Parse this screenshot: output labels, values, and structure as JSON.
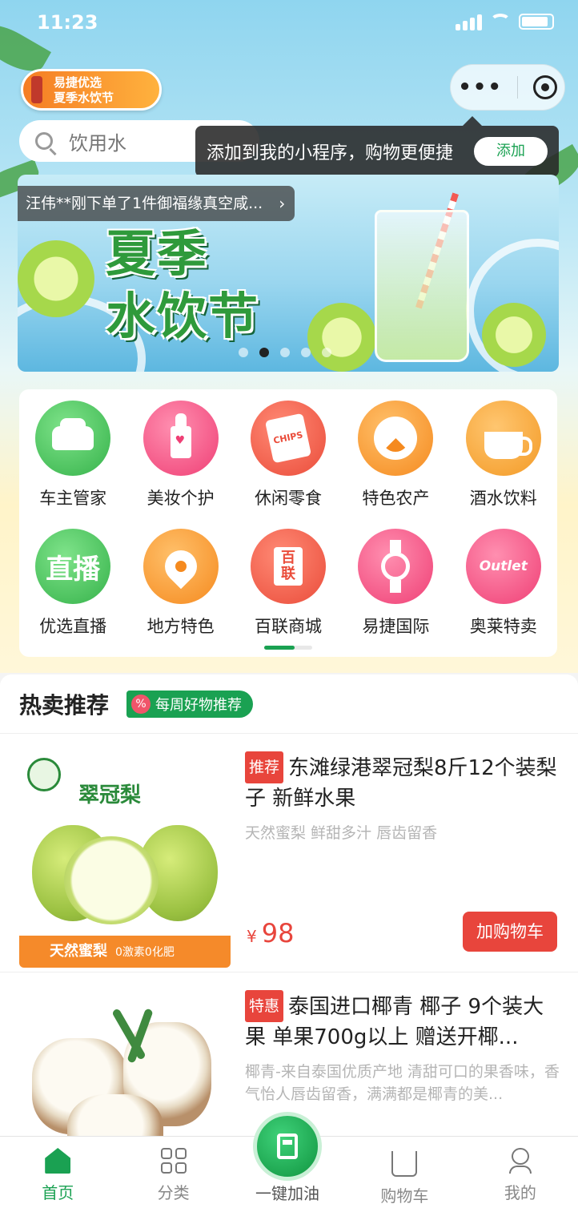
{
  "status_bar": {
    "time": "11:23"
  },
  "header": {
    "festival_logo": {
      "line1": "易捷优选",
      "line2": "夏季水饮节"
    },
    "search": {
      "placeholder": "饮用水"
    },
    "add_tip": {
      "text": "添加到我的小程序，购物更便捷",
      "button": "添加"
    }
  },
  "banner": {
    "title_line1": "夏季",
    "title_line2": "水饮节",
    "order_notice": "汪伟**刚下单了1件御福缘真空咸...",
    "slide_count": 5,
    "active_slide": 1
  },
  "categories": [
    {
      "label": "车主管家",
      "icon": "car-icon",
      "color": "#35b24a"
    },
    {
      "label": "美妆个护",
      "icon": "lipstick-icon",
      "color": "#ef3f75"
    },
    {
      "label": "休闲零食",
      "icon": "chips-icon",
      "color": "#ea4c3a",
      "icon_text": "CHIPS"
    },
    {
      "label": "特色农产",
      "icon": "fruit-icon",
      "color": "#f58a1f"
    },
    {
      "label": "酒水饮料",
      "icon": "coffee-cup-icon",
      "color": "#f39a26"
    },
    {
      "label": "优选直播",
      "icon": "live-icon",
      "color": "#35b24a",
      "icon_text": "直播"
    },
    {
      "label": "地方特色",
      "icon": "location-pin-icon",
      "color": "#f58a1f"
    },
    {
      "label": "百联商城",
      "icon": "bailian-icon",
      "color": "#ea4c3a",
      "icon_text": "百联"
    },
    {
      "label": "易捷国际",
      "icon": "watch-icon",
      "color": "#ef3f75"
    },
    {
      "label": "奥莱特卖",
      "icon": "outlet-icon",
      "color": "#ef3f75",
      "icon_text": "Outlet"
    }
  ],
  "hot_section": {
    "title": "热卖推荐",
    "badge": "每周好物推荐",
    "badge_icon_text": "%"
  },
  "products": [
    {
      "tag": "推荐",
      "name": "东滩绿港翠冠梨8斤12个装梨子 新鲜水果",
      "subtitle": "天然蜜梨 鲜甜多汁 唇齿留香",
      "price_symbol": "¥",
      "price": "98",
      "button": "加购物车",
      "image_title": "翠冠梨",
      "image_band": "天然蜜梨",
      "image_band_small": "0激素0化肥"
    },
    {
      "tag": "特惠",
      "name": "泰国进口椰青 椰子 9个装大果 单果700g以上 赠送开椰...",
      "subtitle": "椰青-来自泰国优质产地 清甜可口的果香味，香气怡人唇齿留香，满满都是椰青的美..."
    }
  ],
  "tabbar": {
    "items": [
      {
        "label": "首页",
        "icon": "home-icon",
        "active": true
      },
      {
        "label": "分类",
        "icon": "grid-icon"
      },
      {
        "label": "一键加油",
        "icon": "fuel-pump-icon"
      },
      {
        "label": "购物车",
        "icon": "cart-icon"
      },
      {
        "label": "我的",
        "icon": "user-icon"
      }
    ]
  },
  "colors": {
    "brand_green": "#1aa152",
    "price_red": "#e8453c",
    "tag_red": "#e8453c"
  }
}
